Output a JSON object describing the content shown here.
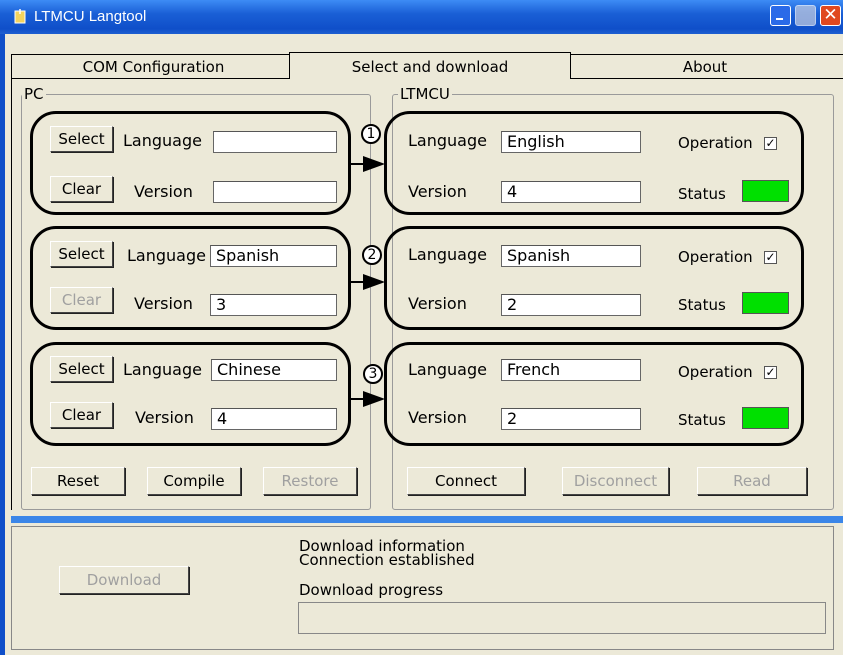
{
  "window": {
    "title": "LTMCU Langtool"
  },
  "tabs": [
    {
      "label": "COM  Configuration"
    },
    {
      "label": "Select  and download"
    },
    {
      "label": "About"
    }
  ],
  "pc": {
    "group_label": "PC",
    "slots": [
      {
        "select": "Select",
        "clear": "Clear",
        "language_label": "Language",
        "language": "",
        "version_label": "Version",
        "version": "",
        "clear_disabled": false
      },
      {
        "select": "Select",
        "clear": "Clear",
        "language_label": "Language",
        "language": "Spanish",
        "version_label": "Version",
        "version": "3",
        "clear_disabled": true
      },
      {
        "select": "Select",
        "clear": "Clear",
        "language_label": "Language",
        "language": "Chinese",
        "version_label": "Version",
        "version": "4",
        "clear_disabled": false
      }
    ],
    "buttons": {
      "reset": "Reset",
      "compile": "Compile",
      "restore": "Restore"
    }
  },
  "ltmcu": {
    "group_label": "LTMCU",
    "slots": [
      {
        "number": "1",
        "language_label": "Language",
        "language": "English",
        "version_label": "Version",
        "version": "4",
        "operation_label": "Operation",
        "operation_checked": true,
        "status_label": "Status",
        "status_color": "#00e000"
      },
      {
        "number": "2",
        "language_label": "Language",
        "language": "Spanish",
        "version_label": "Version",
        "version": "2",
        "operation_label": "Operation",
        "operation_checked": true,
        "status_label": "Status",
        "status_color": "#00e000"
      },
      {
        "number": "3",
        "language_label": "Language",
        "language": "French",
        "version_label": "Version",
        "version": "2",
        "operation_label": "Operation",
        "operation_checked": true,
        "status_label": "Status",
        "status_color": "#00e000"
      }
    ],
    "buttons": {
      "connect": "Connect",
      "disconnect": "Disconnect",
      "read": "Read"
    }
  },
  "download": {
    "button": "Download",
    "info_title": "Download  information",
    "info_text": "Connection  established",
    "progress_label": "Download  progress",
    "progress": 0
  },
  "colors": {
    "titlebar": "#1a5fd6",
    "separator": "#3b86e8",
    "status_ok": "#00e000"
  }
}
